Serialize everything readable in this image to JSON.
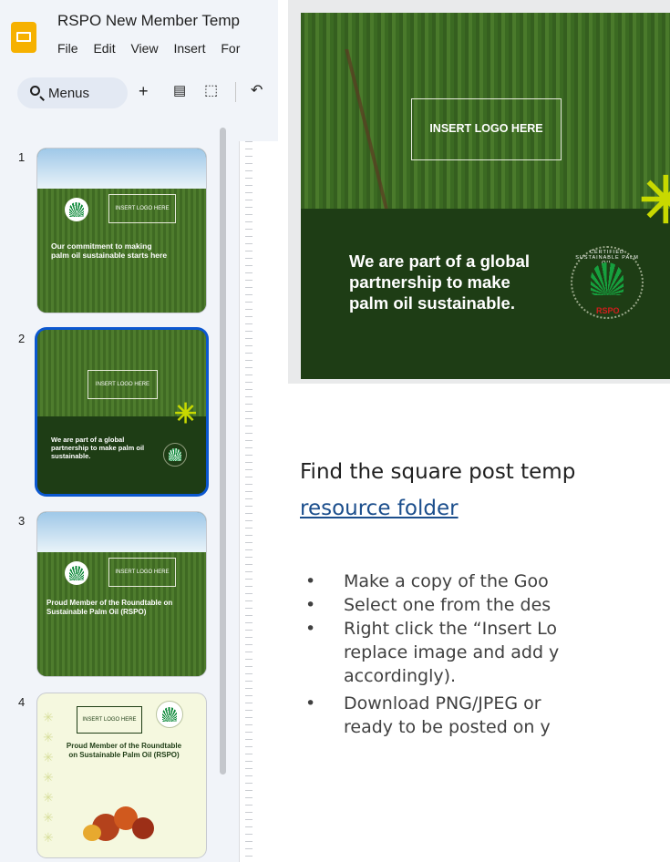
{
  "app": {
    "doc_title": "RSPO New Member Temp",
    "menu": [
      "File",
      "Edit",
      "View",
      "Insert",
      "For"
    ],
    "search_label": "Menus"
  },
  "icons": {
    "app_logo": "google-slides-icon",
    "search": "search-icon",
    "new_slide": "plus-icon",
    "layout": "layout-icon",
    "insert_box": "new-box-icon",
    "undo": "undo-icon"
  },
  "slides": [
    {
      "number": "1",
      "logo_box": "INSERT LOGO HERE",
      "text": "Our commitment to making palm oil sustainable starts here"
    },
    {
      "number": "2",
      "logo_box": "INSERT LOGO HERE",
      "text": "We are part of a global partnership to make palm oil sustainable."
    },
    {
      "number": "3",
      "logo_box": "INSERT LOGO HERE",
      "text": "Proud Member of the Roundtable on Sustainable Palm Oil (RSPO)"
    },
    {
      "number": "4",
      "logo_box": "INSERT LOGO HERE",
      "text": "Proud Member of the Roundtable on Sustainable Palm Oil (RSPO)"
    }
  ],
  "preview": {
    "logo_box": "INSERT LOGO HERE",
    "line1": "We are part of a global",
    "line2": "partnership to make",
    "line3": "palm oil sustainable.",
    "seal_ring": "CERTIFIED SUSTAINABLE PALM OIL",
    "seal_brand": "RSPO"
  },
  "content": {
    "find_text": "Find the square post temp",
    "link_text": "resource folder",
    "bullets": [
      "Make a copy of the Goo",
      "Select one from the des",
      "Right click the “Insert Lo",
      "replace image and add y",
      "accordingly).",
      "Download PNG/JPEG or",
      "ready to be posted on y"
    ]
  },
  "colors": {
    "selected_border": "#0b57d0",
    "dark_green": "#1e3d15",
    "lime_burst": "#c8d900",
    "link": "#1b4e8c"
  }
}
